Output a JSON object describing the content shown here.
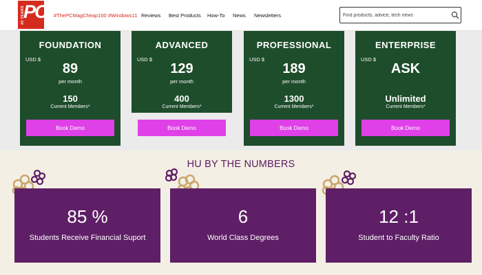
{
  "nav": {
    "logo_text": "PC",
    "logo_years": "40 YEARS",
    "links": [
      "#ThePCMagCheap100",
      "#Windows11",
      "Reviews",
      "Best Products",
      "How-To",
      "News",
      "Newsletters"
    ],
    "search_placeholder": "Find products, advice, tech news"
  },
  "pricing": {
    "plans": [
      {
        "name": "FOUNDATION",
        "currency": "USD $",
        "price": "89",
        "period": "per month",
        "members": "150",
        "members_label": "Current Members*",
        "button": "Book Demo"
      },
      {
        "name": "ADVANCED",
        "currency": "USD $",
        "price": "129",
        "period": "per month",
        "members": "400",
        "members_label": "Current Members*",
        "button": "Book Demo"
      },
      {
        "name": "PROFESSIONAL",
        "currency": "USD $",
        "price": "189",
        "period": "per month",
        "members": "1300",
        "members_label": "Current Members*",
        "button": "Book Demo"
      },
      {
        "name": "ENTERPRISE",
        "currency": "USD $",
        "price": "ASK",
        "period": "",
        "members": "Unlimited",
        "members_label": "Current Members*",
        "button": "Book Demo"
      }
    ]
  },
  "numbers": {
    "title": "HU BY THE NUMBERS",
    "stats": [
      {
        "value": "85 %",
        "label": "Students Receive Financial Suport"
      },
      {
        "value": "6",
        "label": "World Class Degrees"
      },
      {
        "value": "12 :1",
        "label": "Student to Faculty Ratio"
      }
    ]
  },
  "colors": {
    "brand_red": "#d52b1e",
    "card_green": "#1e4d2b",
    "button_magenta": "#e040e8",
    "stat_purple": "#5e1f66",
    "section_cream": "#f4efe4",
    "deco_gold": "#c9a66b"
  }
}
